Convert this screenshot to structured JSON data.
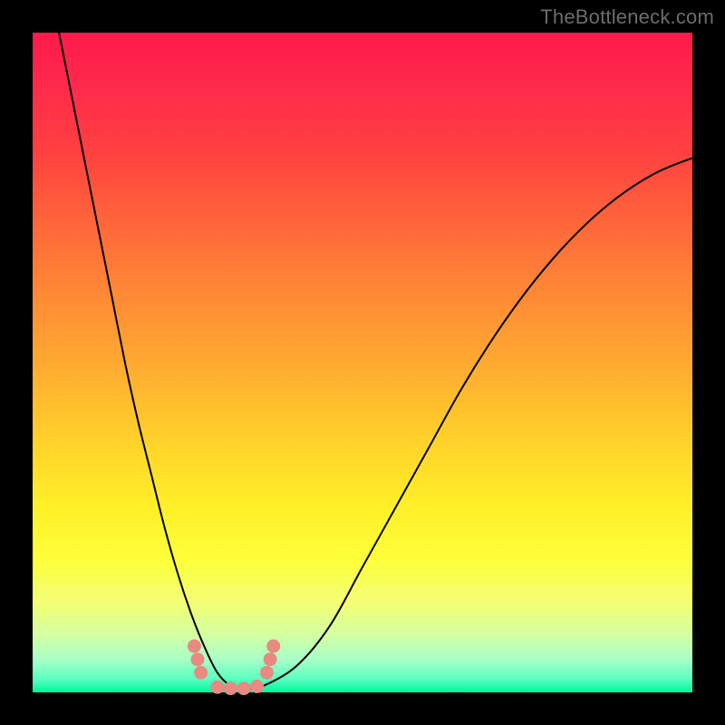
{
  "watermark": "TheBottleneck.com",
  "colors": {
    "frame": "#000000",
    "gradient_top": "#ff1a4b",
    "gradient_bottom": "#00f49a",
    "curve": "#000000",
    "marker": "#e88a82"
  },
  "chart_data": {
    "type": "line",
    "title": "",
    "xlabel": "",
    "ylabel": "",
    "xlim": [
      0,
      100
    ],
    "ylim": [
      0,
      100
    ],
    "grid": false,
    "legend": false,
    "series": [
      {
        "name": "bottleneck-curve",
        "x": [
          4,
          6,
          8,
          10,
          12,
          14,
          16,
          18,
          20,
          22,
          24,
          26,
          28,
          30,
          32,
          35,
          40,
          45,
          50,
          55,
          60,
          65,
          70,
          75,
          80,
          85,
          90,
          95,
          100
        ],
        "y": [
          100,
          90,
          80,
          70,
          60,
          50,
          41,
          33,
          25,
          18,
          12,
          7,
          3,
          1,
          0.5,
          1,
          4,
          10,
          19,
          28,
          37,
          46,
          54,
          61,
          67,
          72,
          76,
          79,
          81
        ]
      }
    ],
    "markers": [
      {
        "x": 24.5,
        "y": 7
      },
      {
        "x": 25.0,
        "y": 5
      },
      {
        "x": 25.5,
        "y": 3
      },
      {
        "x": 28.0,
        "y": 0.8
      },
      {
        "x": 30.0,
        "y": 0.6
      },
      {
        "x": 32.0,
        "y": 0.6
      },
      {
        "x": 34.0,
        "y": 0.9
      },
      {
        "x": 35.5,
        "y": 3
      },
      {
        "x": 36.0,
        "y": 5
      },
      {
        "x": 36.5,
        "y": 7
      }
    ],
    "minimum": {
      "x": 31,
      "y": 0.5
    }
  }
}
